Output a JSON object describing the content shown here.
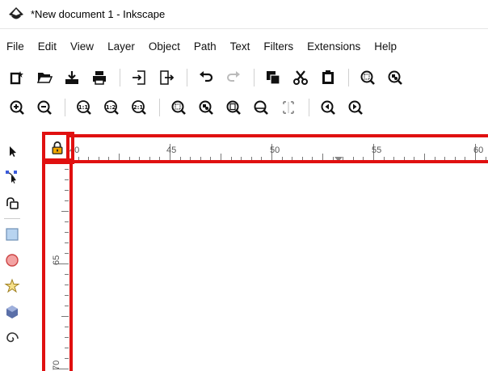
{
  "window": {
    "title": "*New document 1 - Inkscape"
  },
  "menu": {
    "items": [
      "File",
      "Edit",
      "View",
      "Layer",
      "Object",
      "Path",
      "Text",
      "Filters",
      "Extensions",
      "Help"
    ]
  },
  "toolbar1": {
    "icons": [
      "new-document-icon",
      "open-folder-icon",
      "save-icon",
      "print-icon",
      "import-icon",
      "export-icon",
      "undo-icon",
      "redo-icon",
      "copy-icon",
      "cut-icon",
      "paste-icon",
      "zoom-selection-icon",
      "zoom-drawing-icon"
    ]
  },
  "toolbar2": {
    "icons": [
      "zoom-in-icon",
      "zoom-out-icon",
      "zoom-1-1-icon",
      "zoom-1-2-icon",
      "zoom-2-1-icon",
      "zoom-selection-icon",
      "zoom-drawing-icon",
      "zoom-page-icon",
      "zoom-page-width-icon",
      "zoom-center-icon",
      "zoom-previous-icon",
      "zoom-next-icon"
    ],
    "zoom_labels": {
      "one_one": "1:1",
      "one_two": "1:2",
      "two_one": "2:1"
    }
  },
  "tools": [
    "selector-tool-icon",
    "node-tool-icon",
    "tweak-tool-icon",
    "rectangle-tool-icon",
    "ellipse-tool-icon",
    "star-tool-icon",
    "3dbox-tool-icon",
    "spiral-tool-icon"
  ],
  "rulers": {
    "horizontal_labels": [
      "40",
      "45",
      "50",
      "55",
      "60"
    ],
    "vertical_labels": [
      "65",
      "70"
    ]
  },
  "colors": {
    "highlight": "#e01010",
    "lock": "#f0a500"
  }
}
